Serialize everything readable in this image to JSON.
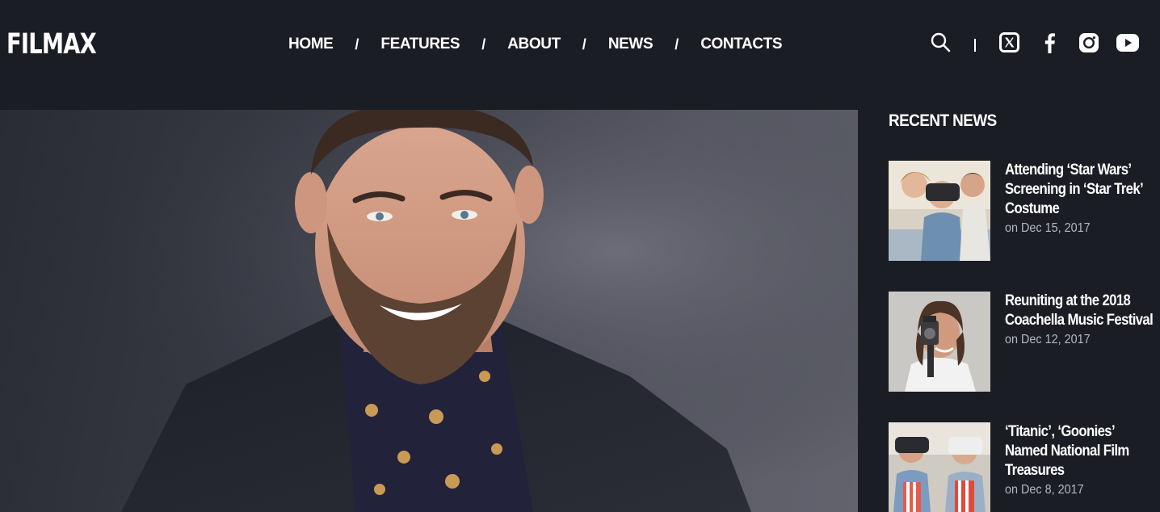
{
  "brand": {
    "logo_text": "FILMAX"
  },
  "nav": {
    "items": [
      "HOME",
      "FEATURES",
      "ABOUT",
      "NEWS",
      "CONTACTS"
    ],
    "separator": "/"
  },
  "header_icons": [
    "search-icon",
    "x-twitter-icon",
    "facebook-icon",
    "instagram-icon",
    "youtube-icon"
  ],
  "sidebar": {
    "title": "RECENT NEWS",
    "items": [
      {
        "title": "Attending ‘Star Wars’ Screening in ‘Star Trek’ Costume",
        "date": "on Dec 15, 2017"
      },
      {
        "title": "Reuniting at the 2018 Coachella Music Festival",
        "date": "on Dec 12, 2017"
      },
      {
        "title": "‘Titanic’, ‘Goonies’ Named National Film Treasures",
        "date": "on Dec 8, 2017"
      }
    ]
  },
  "colors": {
    "background": "#1b1d25",
    "text": "#ffffff",
    "muted_text": "#b7b8bf"
  }
}
